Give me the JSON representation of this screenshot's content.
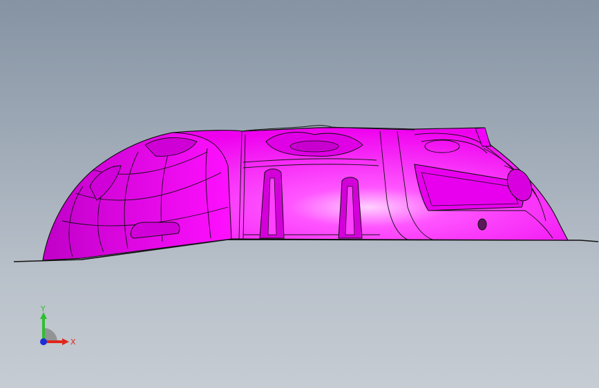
{
  "viewport": {
    "background_top": "#8593a3",
    "background_bottom": "#c6ccd3",
    "part_color": "#ff00ff",
    "edge_color": "#1a0a1a"
  },
  "triad": {
    "x_label": "X",
    "y_label": "Y",
    "x_color": "#e0261b",
    "y_color": "#2fbf2f",
    "z_color": "#1b2fd6"
  }
}
